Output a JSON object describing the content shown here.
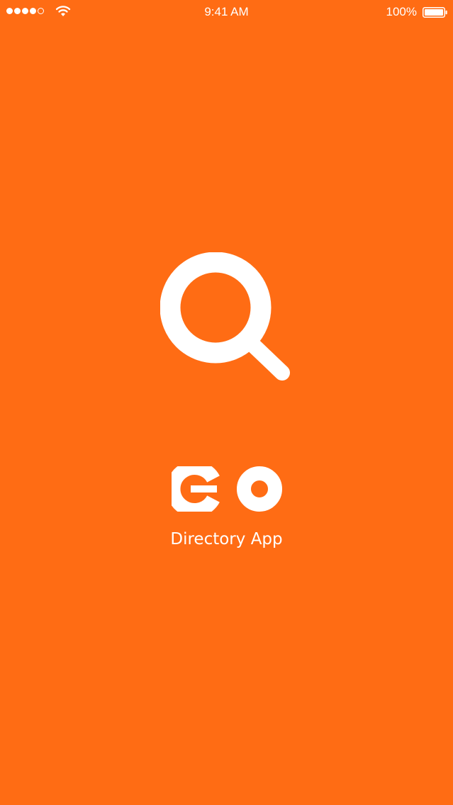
{
  "status_bar": {
    "time": "9:41 AM",
    "battery_percent": "100%",
    "signal_bars_filled": 4,
    "signal_bars_total": 5,
    "wifi_icon": "wifi-icon",
    "battery_icon": "battery-icon"
  },
  "splash": {
    "icon": "search-icon",
    "logo_text": "GO",
    "subtitle": "Directory App"
  },
  "colors": {
    "background": "#ff6c14",
    "foreground": "#ffffff"
  }
}
